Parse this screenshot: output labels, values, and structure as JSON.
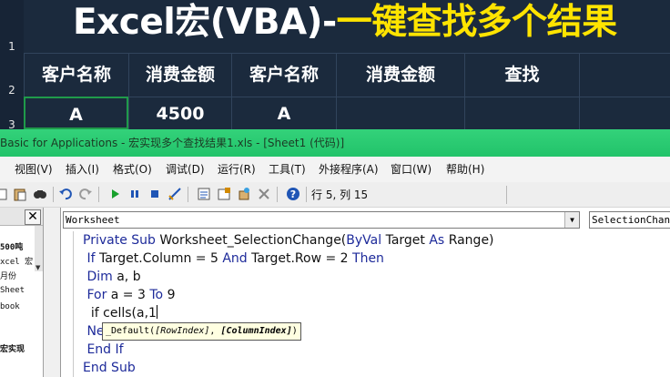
{
  "sheet": {
    "row_numbers": [
      "1",
      "2",
      "3"
    ],
    "title_white": "Excel宏(VBA)-",
    "title_yellow": "一键查找多个结果",
    "headers": [
      "客户名称",
      "消费金额",
      "客户名称",
      "消费金额",
      "查找"
    ],
    "row3": [
      "A",
      "4500",
      "A",
      "",
      ""
    ]
  },
  "vbe": {
    "window_title": "Basic for Applications - 宏实现多个查找结果1.xls - [Sheet1 (代码)]",
    "menu": [
      "视图(V)",
      "插入(I)",
      "格式(O)",
      "调试(D)",
      "运行(R)",
      "工具(T)",
      "外接程序(A)",
      "窗口(W)",
      "帮助(H)"
    ],
    "cursor_position": "行 5, 列 15",
    "object_combo": "Worksheet",
    "procedure_combo": "SelectionChange",
    "project_items": [
      "500吨",
      "xcel 宏",
      "月份",
      "Sheet",
      "book",
      "宏实现"
    ],
    "code": {
      "line1_kw1": "Private Sub ",
      "line1_mid": "Worksheet_SelectionChange(",
      "line1_kw2": "ByVal ",
      "line1_mid2": "Target ",
      "line1_kw3": "As ",
      "line1_end": "Range)",
      "line2_kw1": "If ",
      "line2_mid": "Target.Column = 5 ",
      "line2_kw2": "And ",
      "line2_mid2": "Target.Row = 2 ",
      "line2_kw3": "Then",
      "line3_kw": "Dim ",
      "line3_rest": "a, b",
      "line4_kw1": "For ",
      "line4_mid": "a = 3 ",
      "line4_kw2": "To ",
      "line4_rest": "9",
      "line5": "if cells(a,1",
      "line6_kw": "Ne",
      "line7": "End If",
      "line8": "End Sub"
    },
    "tooltip": {
      "prefix": "_Default(",
      "arg1": "[RowIndex]",
      "sep": ", ",
      "arg2": "[ColumnIndex]",
      "suffix": ")"
    },
    "colors": {
      "titlebar": "#2ecc71",
      "keyword": "#1d2a9a",
      "title_yellow": "#ffe400"
    }
  }
}
